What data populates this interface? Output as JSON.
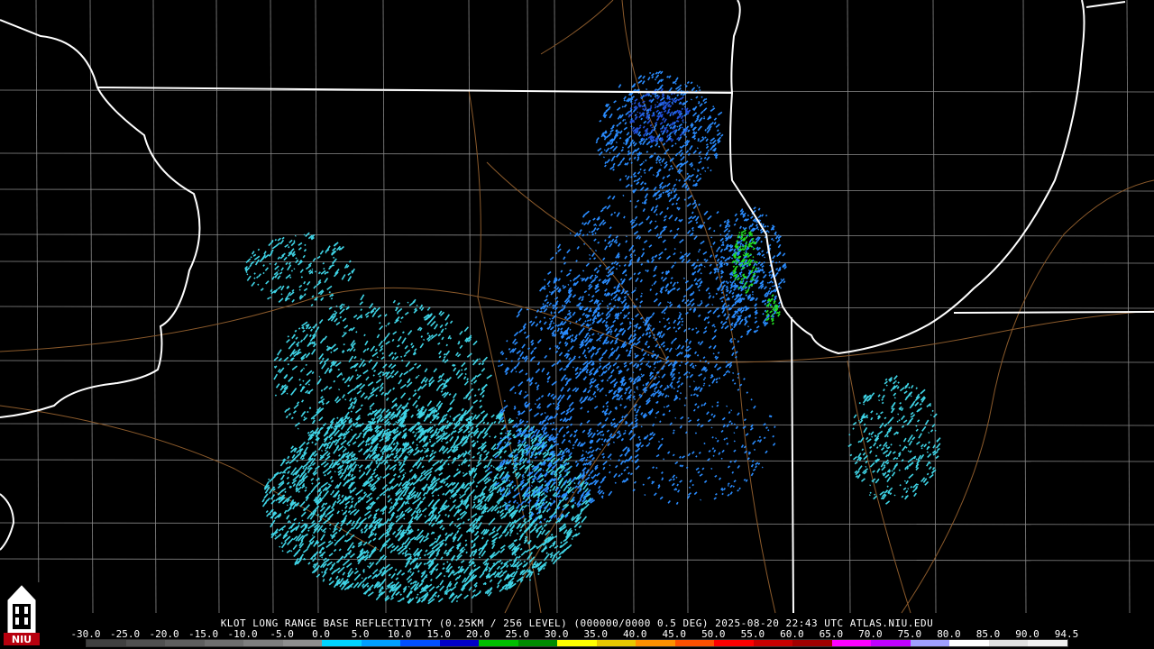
{
  "caption": "KLOT LONG RANGE BASE REFLECTIVITY (0.25KM / 256 LEVEL) (000000/0000 0.5 DEG) 2025-08-20 22:43 UTC  ATLAS.NIU.EDU",
  "logo_text": "NIU",
  "scale_ticks": [
    "-30.0",
    "-25.0",
    "-20.0",
    "-15.0",
    "-10.0",
    "-5.0",
    "0.0",
    "5.0",
    "10.0",
    "15.0",
    "20.0",
    "25.0",
    "30.0",
    "35.0",
    "40.0",
    "45.0",
    "50.0",
    "55.0",
    "60.0",
    "65.0",
    "70.0",
    "75.0",
    "80.0",
    "85.0",
    "90.0",
    "94.5"
  ],
  "colors": {
    "background": "#000000",
    "state_border": "#ffffff",
    "county_line": "#8a8a8a",
    "highway": "#8b5a2b",
    "echo_light": "#3fd4e6",
    "echo_mid": "#2a8cff",
    "echo_strong": "#2050d8",
    "echo_core": "#22dd22",
    "logo_red": "#b8000e"
  },
  "scale_colors": [
    "#404040",
    "#505050",
    "#5e5e5e",
    "#6e6e6e",
    "#7e7e7e",
    "#8e8e8e",
    "#00d4ff",
    "#00a0ff",
    "#0050ff",
    "#0000c8",
    "#00c000",
    "#008c00",
    "#ffff00",
    "#e8c800",
    "#ff9000",
    "#ff5000",
    "#ff0000",
    "#c80000",
    "#a00000",
    "#ff00ff",
    "#c000ff",
    "#a0a0ff",
    "#ffffff",
    "#e0e0e0",
    "#f0f0f0"
  ]
}
